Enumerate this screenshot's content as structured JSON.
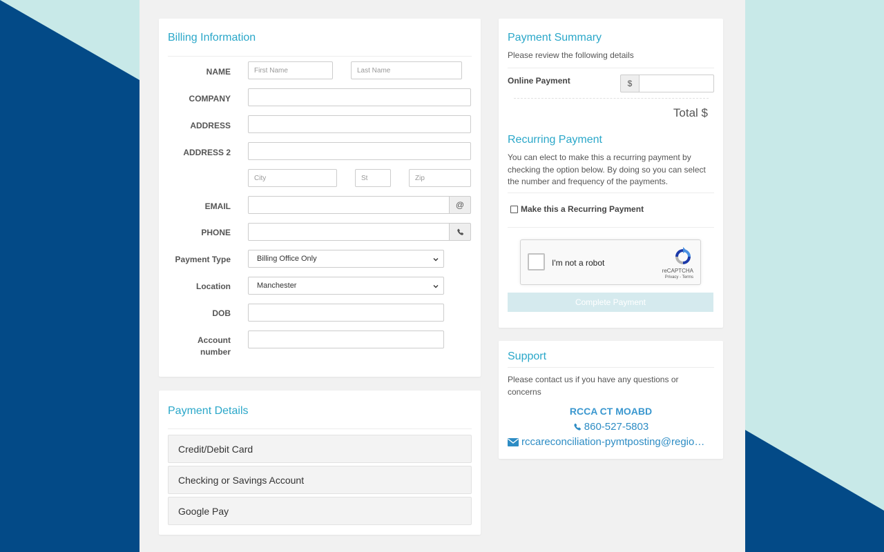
{
  "colors": {
    "accent": "#2aa7c9",
    "background_navy": "#034a87",
    "background_mint": "#c8e9e8",
    "link_blue": "#2d8cc4",
    "button_disabled": "#d5eaee"
  },
  "billing": {
    "title": "Billing Information",
    "labels": {
      "name": "NAME",
      "company": "COMPANY",
      "address": "ADDRESS",
      "address2": "ADDRESS 2",
      "email": "EMAIL",
      "phone": "PHONE",
      "payment_type": "Payment Type",
      "location": "Location",
      "dob": "DOB",
      "account_number_line1": "Account",
      "account_number_line2": "number"
    },
    "placeholders": {
      "first_name": "First Name",
      "last_name": "Last Name",
      "city": "City",
      "state": "St",
      "zip": "Zip"
    },
    "values": {
      "first_name": "",
      "last_name": "",
      "company": "",
      "address": "",
      "address2": "",
      "city": "",
      "state": "",
      "zip": "",
      "email": "",
      "phone": "",
      "dob": "",
      "account_number": ""
    },
    "email_addon": "@",
    "phone_addon_icon": "phone-icon",
    "payment_type_selected": "Billing Office Only",
    "location_selected": "Manchester"
  },
  "payment_details": {
    "title": "Payment Details",
    "options": [
      "Credit/Debit Card",
      "Checking or Savings Account",
      "Google Pay"
    ]
  },
  "summary": {
    "title": "Payment Summary",
    "subtitle": "Please review the following details",
    "online_payment_label": "Online Payment",
    "currency_symbol": "$",
    "amount": "",
    "total_label": "Total $",
    "recurring_title": "Recurring Payment",
    "recurring_text": "You can elect to make this a recurring payment by checking the option below. By doing so you can select the number and frequency of the payments.",
    "recurring_checkbox_label": "Make this a Recurring Payment",
    "captcha_label": "I'm not a robot",
    "captcha_brand": "reCAPTCHA",
    "captcha_links": "Privacy - Terms",
    "complete_button": "Complete Payment"
  },
  "support": {
    "title": "Support",
    "text": "Please contact us if you have any questions or concerns",
    "org_name": "RCCA CT MOABD",
    "phone": "860-527-5803",
    "email": "rccareconciliation-pymtposting@regio…"
  }
}
